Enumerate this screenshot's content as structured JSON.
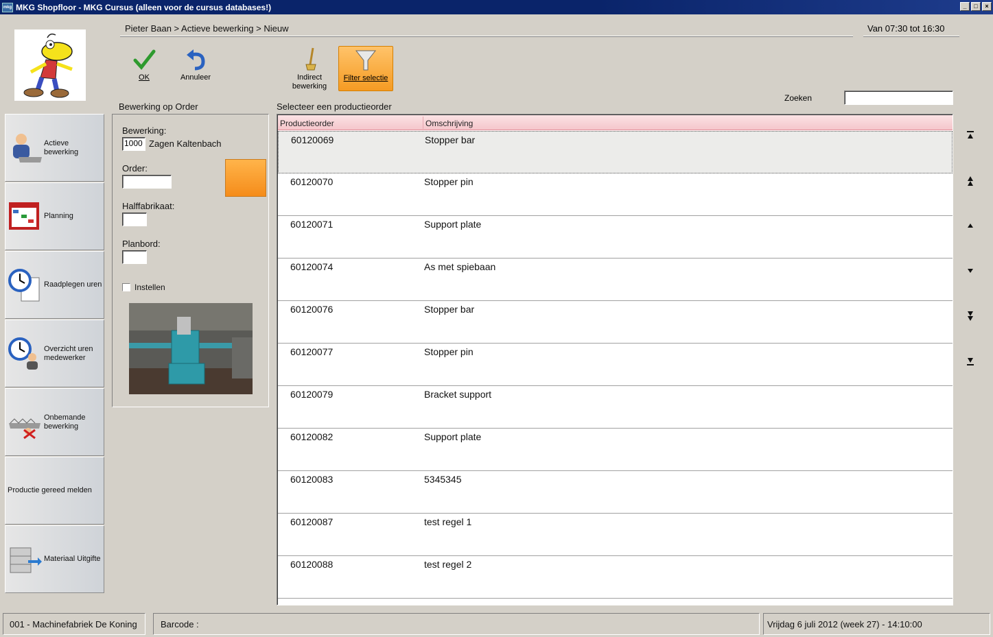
{
  "window": {
    "title": "MKG Shopfloor - MKG Cursus (alleen voor de cursus databases!)",
    "icon_text": "mkg"
  },
  "header": {
    "breadcrumb": "Pieter Baan > Actieve bewerking > Nieuw",
    "shift": "Van 07:30 tot 16:30"
  },
  "toolbar": {
    "ok_label": "OK",
    "cancel_label": "Annuleer",
    "indirect_label_1": "Indirect",
    "indirect_label_2": "bewerking",
    "filter_label": "Filter selectie"
  },
  "sidebar": {
    "items": [
      {
        "label_1": "Actieve",
        "label_2": "bewerking"
      },
      {
        "label_1": "Planning",
        "label_2": ""
      },
      {
        "label_1": "Raadplegen uren",
        "label_2": ""
      },
      {
        "label_1": "Overzicht uren",
        "label_2": "medewerker"
      },
      {
        "label_1": "Onbemande",
        "label_2": "bewerking"
      },
      {
        "label_1": "Productie gereed melden",
        "label_2": ""
      },
      {
        "label_1": "Materiaal Uitgifte",
        "label_2": ""
      }
    ]
  },
  "operation": {
    "section_title": "Bewerking op Order",
    "bewerking_label": "Bewerking:",
    "bewerking_code": "1000",
    "bewerking_name": "Zagen Kaltenbach",
    "order_label": "Order:",
    "order_value": "",
    "halffabrikaat_label": "Halffabrikaat:",
    "halffabrikaat_value": "",
    "planbord_label": "Planbord:",
    "planbord_value": "",
    "instellen_label": "Instellen",
    "instellen_checked": false
  },
  "search": {
    "label": "Zoeken",
    "value": ""
  },
  "orders": {
    "section_title": "Selecteer een productieorder",
    "columns": [
      "Productieorder",
      "Omschrijving"
    ],
    "selected_index": 0,
    "rows": [
      {
        "order": "60120069",
        "desc": "Stopper bar"
      },
      {
        "order": "60120070",
        "desc": "Stopper pin"
      },
      {
        "order": "60120071",
        "desc": "Support plate"
      },
      {
        "order": "60120074",
        "desc": "As met spiebaan"
      },
      {
        "order": "60120076",
        "desc": "Stopper bar"
      },
      {
        "order": "60120077",
        "desc": "Stopper pin"
      },
      {
        "order": "60120079",
        "desc": "Bracket support"
      },
      {
        "order": "60120082",
        "desc": "Support plate"
      },
      {
        "order": "60120083",
        "desc": "5345345"
      },
      {
        "order": "60120087",
        "desc": "test regel 1"
      },
      {
        "order": "60120088",
        "desc": "test regel 2"
      }
    ]
  },
  "statusbar": {
    "company": "001 - Machinefabriek De Koning",
    "barcode_label": "Barcode :",
    "datetime": "Vrijdag 6 juli 2012 (week 27)  -  14:10:00"
  },
  "colors": {
    "title_bar": "#0a246a",
    "accent_orange": "#f59b23",
    "header_pink": "#f5c6cb",
    "window_bg": "#d4d0c8"
  }
}
